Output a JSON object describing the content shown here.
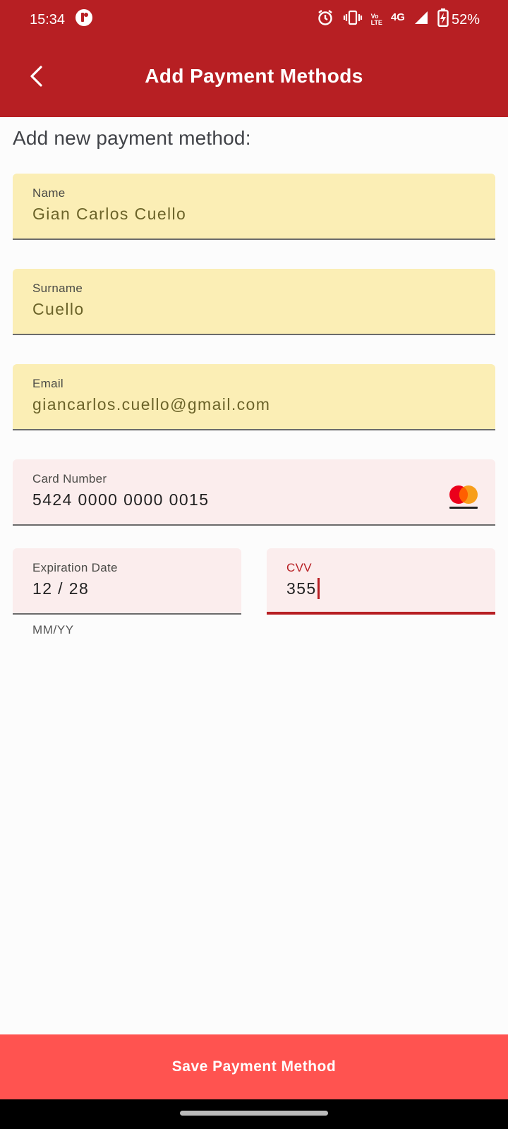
{
  "status_bar": {
    "time": "15:34",
    "volte_top": "Vo",
    "volte_bottom": "LTE",
    "network": "4G",
    "battery": "52%"
  },
  "app_bar": {
    "title": "Add Payment Methods"
  },
  "form": {
    "heading": "Add new payment method:",
    "name": {
      "label": "Name",
      "value": "Gian Carlos Cuello"
    },
    "surname": {
      "label": "Surname",
      "value": "Cuello"
    },
    "email": {
      "label": "Email",
      "value": "giancarlos.cuello@gmail.com"
    },
    "card_number": {
      "label": "Card Number",
      "value": "5424 0000 0000 0015",
      "brand": "mastercard"
    },
    "expiration": {
      "label": "Expiration Date",
      "value": "12 / 28",
      "helper": "MM/YY"
    },
    "cvv": {
      "label": "CVV",
      "value": "355"
    }
  },
  "actions": {
    "save_label": "Save Payment Method"
  },
  "colors": {
    "primary": "#b71f23",
    "button": "#ff5350",
    "field_yellow": "#fbeeb5",
    "field_pink": "#fbeded"
  }
}
